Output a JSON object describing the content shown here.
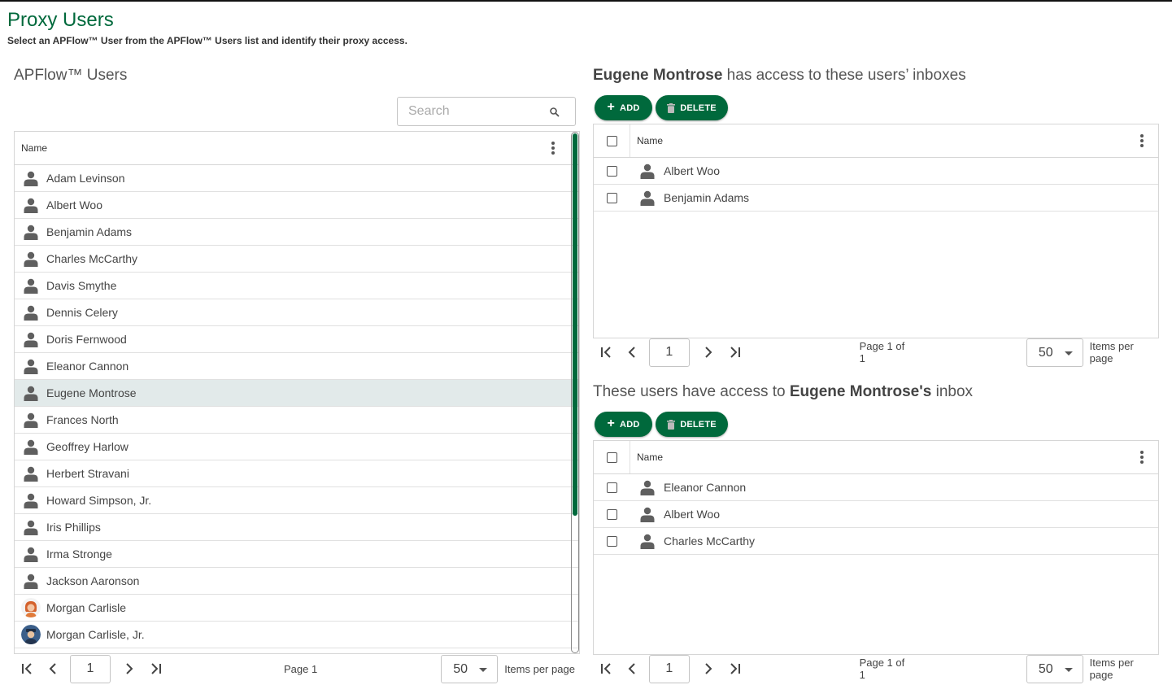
{
  "page": {
    "title": "Proxy Users",
    "subtitle": "Select an APFlow™ User from the APFlow™ Users list and identify their proxy access."
  },
  "colors": {
    "accent": "#00693c",
    "selected_row": "#e2eaea"
  },
  "left": {
    "title": "APFlow™ Users",
    "search_placeholder": "Search",
    "column_name": "Name",
    "users": [
      {
        "name": "Adam Levinson",
        "icon": "user-icon"
      },
      {
        "name": "Albert Woo",
        "icon": "user-icon"
      },
      {
        "name": "Benjamin Adams",
        "icon": "user-icon"
      },
      {
        "name": "Charles McCarthy",
        "icon": "user-icon"
      },
      {
        "name": "Davis Smythe",
        "icon": "user-icon"
      },
      {
        "name": "Dennis Celery",
        "icon": "user-icon"
      },
      {
        "name": "Doris Fernwood",
        "icon": "user-icon"
      },
      {
        "name": "Eleanor Cannon",
        "icon": "user-icon"
      },
      {
        "name": "Eugene Montrose",
        "icon": "user-icon",
        "selected": true
      },
      {
        "name": "Frances North",
        "icon": "user-icon"
      },
      {
        "name": "Geoffrey Harlow",
        "icon": "user-icon"
      },
      {
        "name": "Herbert Stravani",
        "icon": "user-icon"
      },
      {
        "name": "Howard Simpson, Jr.",
        "icon": "user-icon"
      },
      {
        "name": "Iris Phillips",
        "icon": "user-icon"
      },
      {
        "name": "Irma Stronge",
        "icon": "user-icon"
      },
      {
        "name": "Jackson Aaronson",
        "icon": "user-icon"
      },
      {
        "name": "Morgan Carlisle",
        "icon": "avatar-redhair-icon"
      },
      {
        "name": "Morgan Carlisle, Jr.",
        "icon": "avatar-cap-icon"
      }
    ],
    "pager": {
      "page_value": "1",
      "page_label": "Page 1",
      "per_page": "50",
      "per_page_label": "Items per page"
    }
  },
  "right_top": {
    "title_bold": "Eugene Montrose",
    "title_rest": " has access to these users’ inboxes",
    "add_label": "ADD",
    "delete_label": "DELETE",
    "column_name": "Name",
    "users": [
      "Albert Woo",
      "Benjamin Adams"
    ],
    "pager": {
      "page_value": "1",
      "page_label": "Page 1 of 1",
      "per_page": "50",
      "per_page_label": "Items per page"
    }
  },
  "right_bottom": {
    "title_pre": "These users have access to ",
    "title_bold": "Eugene Montrose's",
    "title_post": " inbox",
    "add_label": "ADD",
    "delete_label": "DELETE",
    "column_name": "Name",
    "users": [
      "Eleanor Cannon",
      "Albert Woo",
      "Charles McCarthy"
    ],
    "pager": {
      "page_value": "1",
      "page_label": "Page 1 of 1",
      "per_page": "50",
      "per_page_label": "Items per page"
    }
  }
}
